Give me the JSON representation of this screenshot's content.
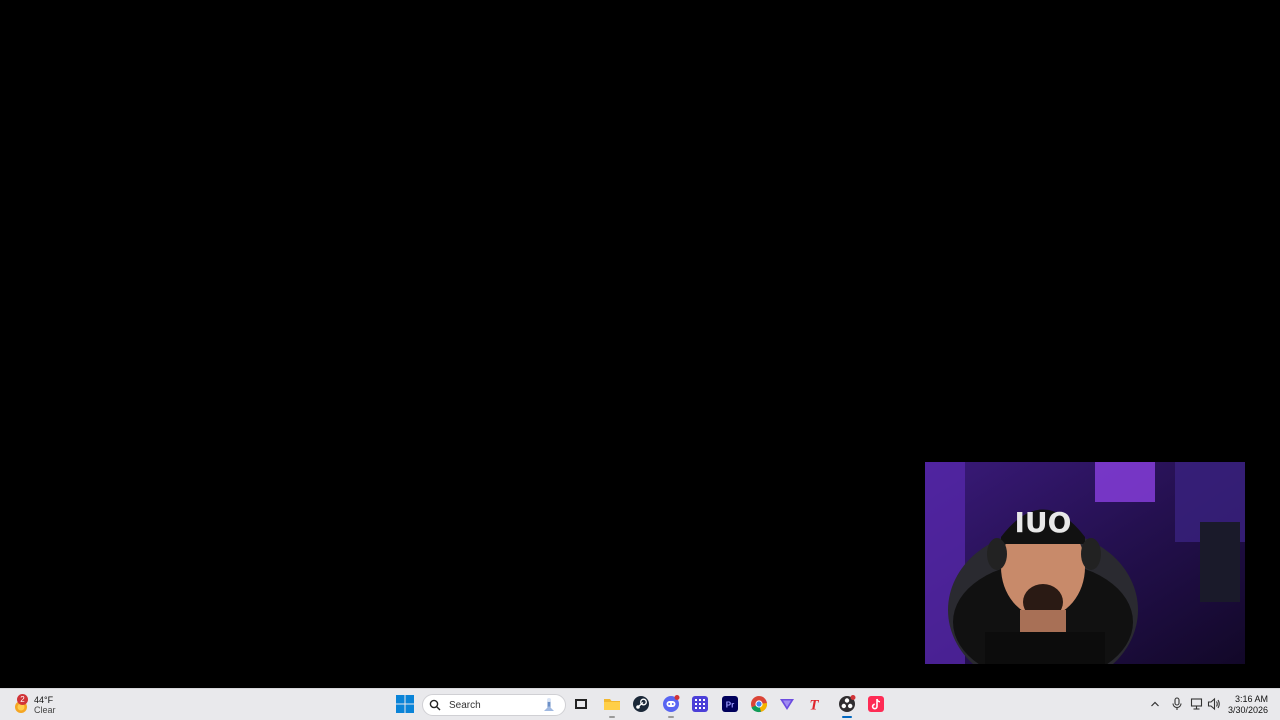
{
  "taskbar": {
    "weather": {
      "badge": "2",
      "temperature": "44°F",
      "condition": "Clear",
      "icon": "weather-sun-icon"
    },
    "search": {
      "label": "Search",
      "icon": "search-icon"
    },
    "apps": [
      {
        "name": "task-view",
        "icon": "task-view-icon"
      },
      {
        "name": "file-explorer",
        "icon": "folder-icon"
      },
      {
        "name": "steam",
        "icon": "steam-icon"
      },
      {
        "name": "discord",
        "icon": "discord-icon"
      },
      {
        "name": "app-grid",
        "icon": "grid-app-icon"
      },
      {
        "name": "premiere-pro",
        "icon": "premiere-pro-icon",
        "label": "Pr"
      },
      {
        "name": "chrome",
        "icon": "chrome-icon"
      },
      {
        "name": "vpn",
        "icon": "vpn-triangle-icon"
      },
      {
        "name": "text-app",
        "icon": "text-t-icon",
        "label": "T"
      },
      {
        "name": "obs",
        "icon": "obs-icon"
      },
      {
        "name": "tiktok",
        "icon": "tiktok-icon"
      }
    ],
    "tray": {
      "chevron": "chevron-up-icon",
      "icons": [
        "microphone-icon",
        "network-icon",
        "speaker-icon"
      ]
    },
    "clock": {
      "time": "3:16 AM",
      "date": "3/30/2026"
    }
  },
  "colors": {
    "desktop": "#000000",
    "taskbar": "#e9e9ec",
    "accent": "#0067c0",
    "badge": "#d13438"
  }
}
